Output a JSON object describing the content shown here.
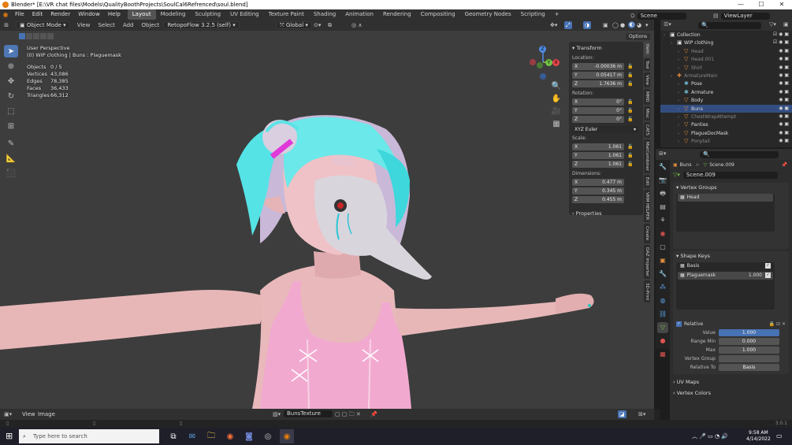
{
  "window": {
    "title": "Blender* [E:\\VR chat files\\Models\\QualityBoothProjects\\SoulCal6Refrenced\\soul.blend]",
    "minimize": "—",
    "maximize": "☐",
    "close": "✕"
  },
  "menu": [
    "File",
    "Edit",
    "Render",
    "Window",
    "Help"
  ],
  "workspaces": [
    "Layout",
    "Modeling",
    "Sculpting",
    "UV Editing",
    "Texture Paint",
    "Shading",
    "Animation",
    "Rendering",
    "Compositing",
    "Geometry Nodes",
    "Scripting"
  ],
  "active_workspace": "Layout",
  "add_workspace": "+",
  "scene_name": "Scene",
  "view_layer": "ViewLayer",
  "viewport_header": {
    "mode": "Object Mode",
    "view": "View",
    "select": "Select",
    "add": "Add",
    "object": "Object",
    "addon": "RetopoFlow 3.2.5 (self)",
    "transform": "Global",
    "options": "Options"
  },
  "overlay": {
    "perspective": "User Perspective",
    "object": "(0) WIP clothing | Buns : Plaguemask",
    "stats": [
      {
        "label": "Objects",
        "value": "0 / 5"
      },
      {
        "label": "Vertices",
        "value": "43,086"
      },
      {
        "label": "Edges",
        "value": "78,385"
      },
      {
        "label": "Faces",
        "value": "36,433"
      },
      {
        "label": "Triangles",
        "value": "66,312"
      }
    ]
  },
  "gizmo": {
    "x": "X",
    "y": "Y",
    "z": "Z"
  },
  "npanel": {
    "title": "Transform",
    "location_label": "Location:",
    "location": [
      {
        "axis": "X",
        "value": "-0.00036 m"
      },
      {
        "axis": "Y",
        "value": "0.05417 m"
      },
      {
        "axis": "Z",
        "value": "1.7636 m"
      }
    ],
    "rotation_label": "Rotation:",
    "rotation": [
      {
        "axis": "X",
        "value": "0°"
      },
      {
        "axis": "Y",
        "value": "0°"
      },
      {
        "axis": "Z",
        "value": "0°"
      }
    ],
    "rotation_mode": "XYZ Euler",
    "scale_label": "Scale:",
    "scale": [
      {
        "axis": "X",
        "value": "1.061"
      },
      {
        "axis": "Y",
        "value": "1.061"
      },
      {
        "axis": "Z",
        "value": "1.061"
      }
    ],
    "dimensions_label": "Dimensions:",
    "dimensions": [
      {
        "axis": "X",
        "value": "0.477 m"
      },
      {
        "axis": "Y",
        "value": "0.345 m"
      },
      {
        "axis": "Z",
        "value": "0.455 m"
      }
    ],
    "properties": "Properties"
  },
  "side_tabs": [
    "Item",
    "Tool",
    "View",
    "MMD",
    "Misc",
    "CATS",
    "MatCombiner",
    "Edit",
    "VRM HELPER",
    "Create",
    "DAZ Importer",
    "3D-Print"
  ],
  "outliner": {
    "rows": [
      {
        "name": "Collection",
        "indent": 0,
        "icon": "▣",
        "color": "#ddd",
        "dim": false
      },
      {
        "name": "WIP clothing",
        "indent": 1,
        "icon": "▣",
        "color": "#ddd",
        "dim": false
      },
      {
        "name": "Head",
        "indent": 2,
        "icon": "▽",
        "color": "#e38d3c",
        "dim": true
      },
      {
        "name": "Head.001",
        "indent": 2,
        "icon": "▽",
        "color": "#e38d3c",
        "dim": true
      },
      {
        "name": "Shirt",
        "indent": 2,
        "icon": "▽",
        "color": "#e38d3c",
        "dim": true
      },
      {
        "name": "ArmatureMain",
        "indent": 1,
        "icon": "✚",
        "color": "#e38d3c",
        "dim": true
      },
      {
        "name": "Pose",
        "indent": 2,
        "icon": "✱",
        "color": "#6fb6cf",
        "dim": false
      },
      {
        "name": "Armature",
        "indent": 2,
        "icon": "✱",
        "color": "#6fb6cf",
        "dim": false
      },
      {
        "name": "Body",
        "indent": 2,
        "icon": "▽",
        "color": "#e38d3c",
        "dim": false
      },
      {
        "name": "Buns",
        "indent": 2,
        "icon": "▽",
        "color": "#e38d3c",
        "dim": false
      },
      {
        "name": "ChestWrapAttempt",
        "indent": 2,
        "icon": "▽",
        "color": "#e38d3c",
        "dim": true
      },
      {
        "name": "Panties",
        "indent": 2,
        "icon": "▽",
        "color": "#e38d3c",
        "dim": false
      },
      {
        "name": "PlagueDocMask",
        "indent": 2,
        "icon": "▽",
        "color": "#e38d3c",
        "dim": false
      },
      {
        "name": "Ponytail",
        "indent": 2,
        "icon": "▽",
        "color": "#e38d3c",
        "dim": true
      }
    ]
  },
  "properties": {
    "breadcrumb_object": "Buns",
    "breadcrumb_sep": ">",
    "breadcrumb_mesh": "Scene.009",
    "mesh_name": "Scene.009",
    "vertex_groups": {
      "title": "Vertex Groups",
      "items": [
        "Head"
      ]
    },
    "shape_keys": {
      "title": "Shape Keys",
      "items": [
        {
          "name": "Basis",
          "value": ""
        },
        {
          "name": "Plaguemask",
          "value": "1.000"
        }
      ]
    },
    "relative": "Relative",
    "fields": [
      {
        "label": "Value",
        "value": "1.000",
        "blue": true
      },
      {
        "label": "Range Min",
        "value": "0.000",
        "blue": false
      },
      {
        "label": "Max",
        "value": "1.000",
        "blue": false
      },
      {
        "label": "Vertex Group",
        "value": "",
        "blue": false
      },
      {
        "label": "Relative To",
        "value": "Basis",
        "blue": false
      }
    ],
    "uv_maps": "UV Maps",
    "vertex_colors": "Vertex Colors"
  },
  "bottom_bar": {
    "view": "View",
    "image": "Image",
    "texture": "BunsTexture"
  },
  "version": "3.0.1",
  "taskbar": {
    "search_placeholder": "Type here to search",
    "time": "9:58 AM",
    "date": "4/14/2022"
  },
  "colors": {
    "accent": "#4772b3",
    "orange": "#e38d3c",
    "header": "#303030"
  }
}
